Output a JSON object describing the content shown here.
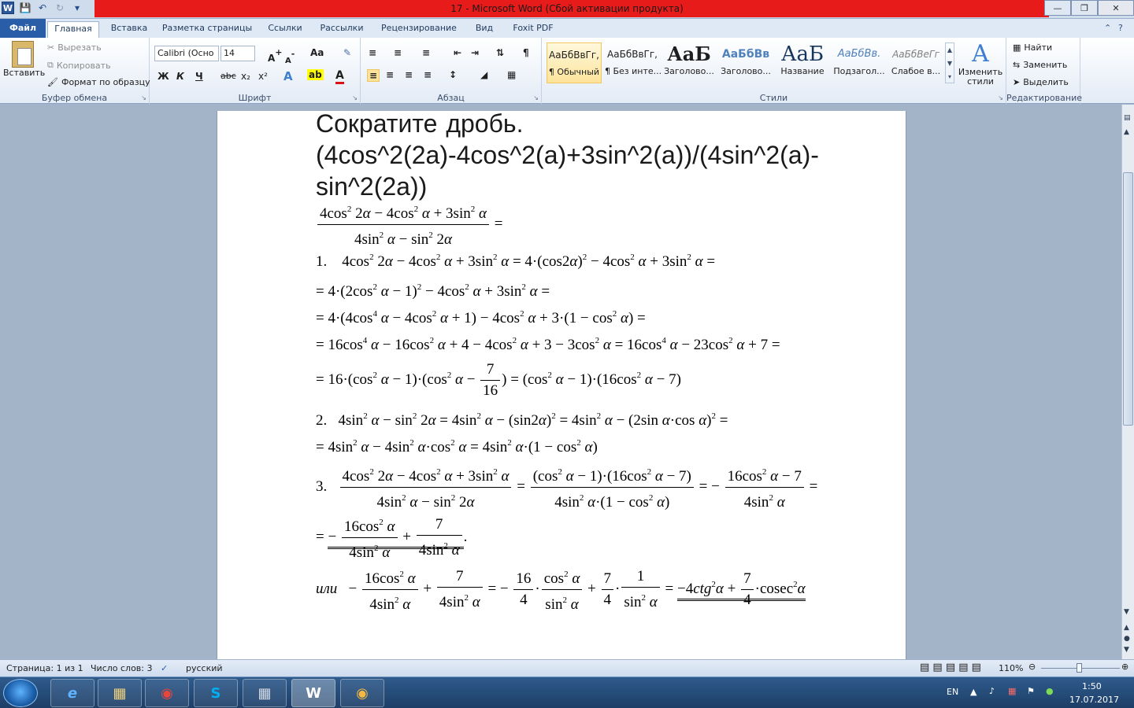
{
  "window": {
    "title": "17  -  Microsoft Word (Сбой активации продукта)"
  },
  "tabs": [
    {
      "label": "Файл"
    },
    {
      "label": "Главная"
    },
    {
      "label": "Вставка"
    },
    {
      "label": "Разметка страницы"
    },
    {
      "label": "Ссылки"
    },
    {
      "label": "Рассылки"
    },
    {
      "label": "Рецензирование"
    },
    {
      "label": "Вид"
    },
    {
      "label": "Foxit PDF"
    }
  ],
  "clipboard": {
    "paste": "Вставить",
    "cut": "Вырезать",
    "copy": "Копировать",
    "format_painter": "Формат по образцу",
    "group": "Буфер обмена"
  },
  "font": {
    "name": "Calibri (Осно",
    "size": "14",
    "group": "Шрифт",
    "bold": "Ж",
    "italic": "К",
    "underline": "Ч",
    "strike": "abc",
    "grow": "A",
    "shrink": "A",
    "case": "Aa",
    "sub": "x₂",
    "sup": "x²"
  },
  "paragraph": {
    "group": "Абзац"
  },
  "styles": {
    "group": "Стили",
    "change_styles": "Изменить стили",
    "items": [
      {
        "preview": "АаБбВвГг,",
        "name": "¶ Обычный"
      },
      {
        "preview": "АаБбВвГг,",
        "name": "¶ Без инте..."
      },
      {
        "preview": "АаБ",
        "name": "Заголово..."
      },
      {
        "preview": "АаБбВв",
        "name": "Заголово..."
      },
      {
        "preview": "АаБ",
        "name": "Название"
      },
      {
        "preview": "АаБбВв.",
        "name": "Подзагол..."
      },
      {
        "preview": "АаБбВеГг",
        "name": "Слабое в..."
      }
    ]
  },
  "editing": {
    "group": "Редактирование",
    "find": "Найти",
    "replace": "Заменить",
    "select": "Выделить"
  },
  "document": {
    "heading": "Сократите дробь. (4cos^2(2a)-4cos^2(a)+3sin^2(a))/(4sin^2(a)-sin^2(2a))"
  },
  "status": {
    "page": "Страница: 1 из 1",
    "words": "Число слов: 3",
    "language": "русский",
    "zoom": "110%"
  },
  "tray": {
    "lang": "EN",
    "time": "1:50",
    "date": "17.07.2017"
  },
  "colors": {
    "title_red": "#e81b1b",
    "file_tab": "#2a5da8",
    "taskbar": "#1d3e67"
  }
}
